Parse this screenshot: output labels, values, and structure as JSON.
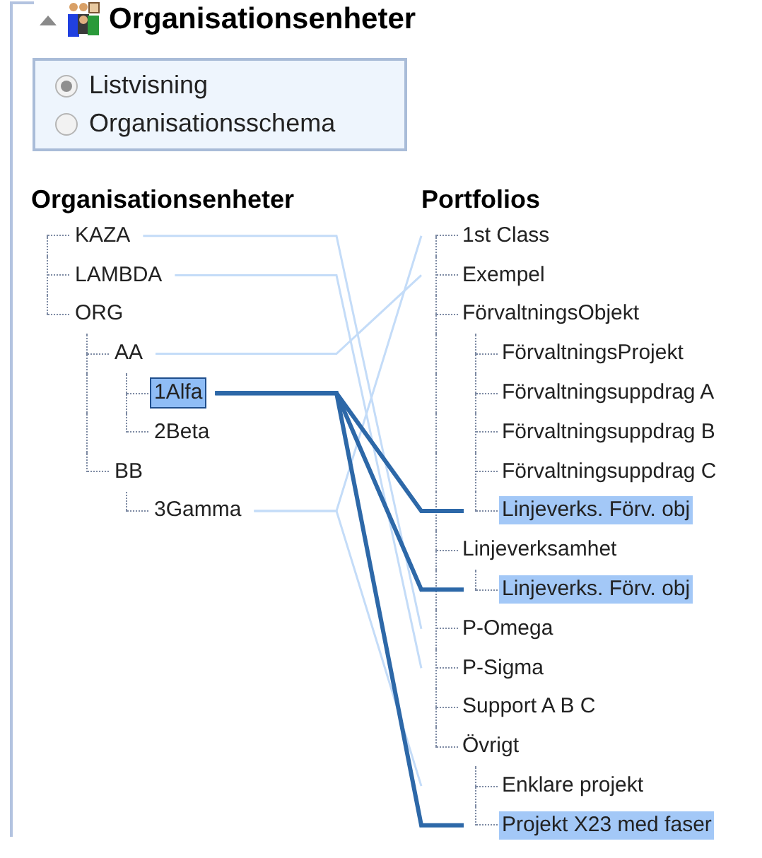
{
  "panel": {
    "title": "Organisationsenheter",
    "expanded": true
  },
  "view_options": [
    {
      "label": "Listvisning",
      "selected": true
    },
    {
      "label": "Organisationsschema",
      "selected": false
    }
  ],
  "org_tree": {
    "heading": "Organisationsenheter",
    "items": [
      {
        "label": "KAZA",
        "selected": false
      },
      {
        "label": "LAMBDA",
        "selected": false
      },
      {
        "label": "ORG",
        "selected": false,
        "children": [
          {
            "label": "AA",
            "selected": false,
            "children": [
              {
                "label": "1Alfa",
                "selected": true
              },
              {
                "label": "2Beta",
                "selected": false
              }
            ]
          },
          {
            "label": "BB",
            "selected": false,
            "children": [
              {
                "label": "3Gamma",
                "selected": false
              }
            ]
          }
        ]
      }
    ]
  },
  "portfolio_tree": {
    "heading": "Portfolios",
    "items": [
      {
        "label": "1st Class",
        "highlighted": false
      },
      {
        "label": "Exempel",
        "highlighted": false
      },
      {
        "label": "FörvaltningsObjekt",
        "highlighted": false,
        "children": [
          {
            "label": "FörvaltningsProjekt",
            "highlighted": false
          },
          {
            "label": "Förvaltningsuppdrag A",
            "highlighted": false
          },
          {
            "label": "Förvaltningsuppdrag B",
            "highlighted": false
          },
          {
            "label": "Förvaltningsuppdrag C",
            "highlighted": false
          },
          {
            "label": "Linjeverks. Förv. obj",
            "highlighted": true
          }
        ]
      },
      {
        "label": "Linjeverksamhet",
        "highlighted": false,
        "children": [
          {
            "label": "Linjeverks. Förv. obj",
            "highlighted": true
          }
        ]
      },
      {
        "label": "P-Omega",
        "highlighted": false
      },
      {
        "label": "P-Sigma",
        "highlighted": false
      },
      {
        "label": "Support A B C",
        "highlighted": false
      },
      {
        "label": "Övrigt",
        "highlighted": false,
        "children": [
          {
            "label": "Enklare projekt",
            "highlighted": false
          },
          {
            "label": "Projekt X23 med faser",
            "highlighted": true
          }
        ]
      }
    ]
  }
}
